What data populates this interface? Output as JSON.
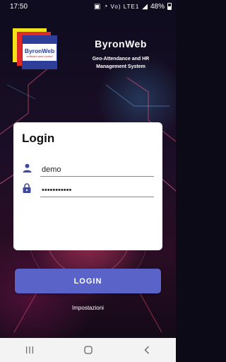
{
  "status_bar": {
    "time": "17:50",
    "network_label": "Vo) LTE1",
    "battery": "48%"
  },
  "logo": {
    "title": "ByronWeb",
    "subtitle": "software pest control"
  },
  "brand": {
    "name": "ByronWeb",
    "tagline_line1": "Geo-Attendance and HR",
    "tagline_line2": "Management System"
  },
  "login_card": {
    "title": "Login",
    "username_value": "demo",
    "password_value": "•••••••••••"
  },
  "login_button": {
    "label": "LOGIN"
  },
  "settings_link": {
    "label": "Impostazioni"
  },
  "colors": {
    "accent": "#5a63c8",
    "icon": "#3f4a9e"
  }
}
